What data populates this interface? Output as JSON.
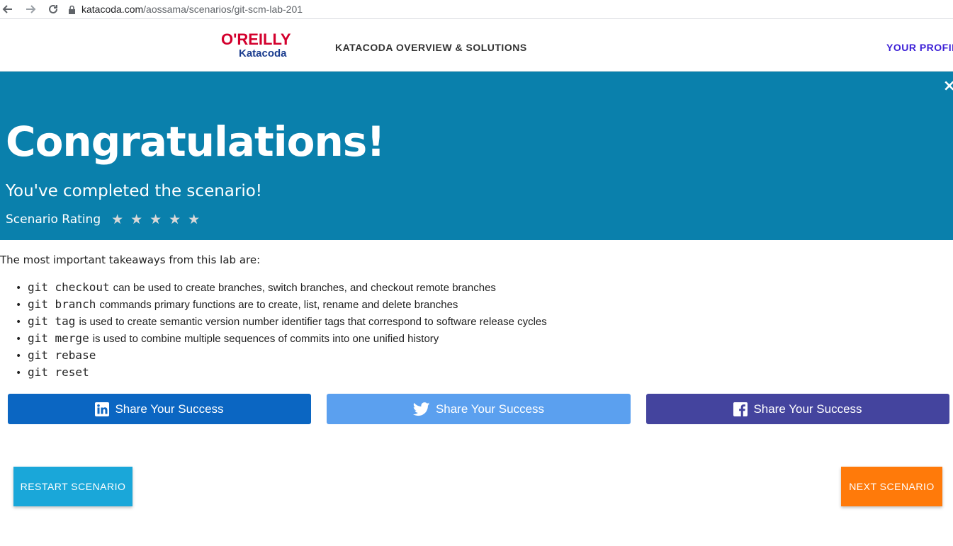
{
  "browser": {
    "url_host": "katacoda.com",
    "url_path": "/aossama/scenarios/git-scm-lab-201"
  },
  "header": {
    "logo_top": "O'REILLY",
    "logo_bottom": "Katacoda",
    "nav_overview": "KATACODA OVERVIEW & SOLUTIONS",
    "nav_profile": "YOUR PROFILE"
  },
  "banner": {
    "title": "Congratulations!",
    "subtitle": "You've completed the scenario!",
    "rating_label": "Scenario Rating",
    "close_symbol": "×",
    "star_symbol": "★",
    "background_color": "#0a80ac"
  },
  "takeaways": {
    "intro": "The most important takeaways from this lab are:",
    "items": [
      {
        "code": "git checkout",
        "text": "can be used to create branches, switch branches, and checkout remote branches"
      },
      {
        "code": "git branch",
        "text": "commands primary functions are to create, list, rename and delete branches"
      },
      {
        "code": "git tag",
        "text": "is used to create semantic version number identifier tags that correspond to software release cycles"
      },
      {
        "code": "git merge",
        "text": "is used to combine multiple sequences of commits into one unified history"
      },
      {
        "code": "git rebase",
        "text": ""
      },
      {
        "code": "git reset",
        "text": ""
      }
    ]
  },
  "share": {
    "linkedin_label": "Share Your Success",
    "twitter_label": "Share Your Success",
    "facebook_label": "Share Your Success",
    "linkedin_icon": "linkedin-icon",
    "twitter_icon": "twitter-icon",
    "facebook_icon": "facebook-icon",
    "linkedin_color": "#0b66c2",
    "twitter_color": "#5ba0ef",
    "facebook_color": "#44449e"
  },
  "actions": {
    "restart_label": "RESTART SCENARIO",
    "next_label": "NEXT SCENARIO",
    "restart_color": "#1aa7d9",
    "next_color": "#ff7a0a"
  }
}
